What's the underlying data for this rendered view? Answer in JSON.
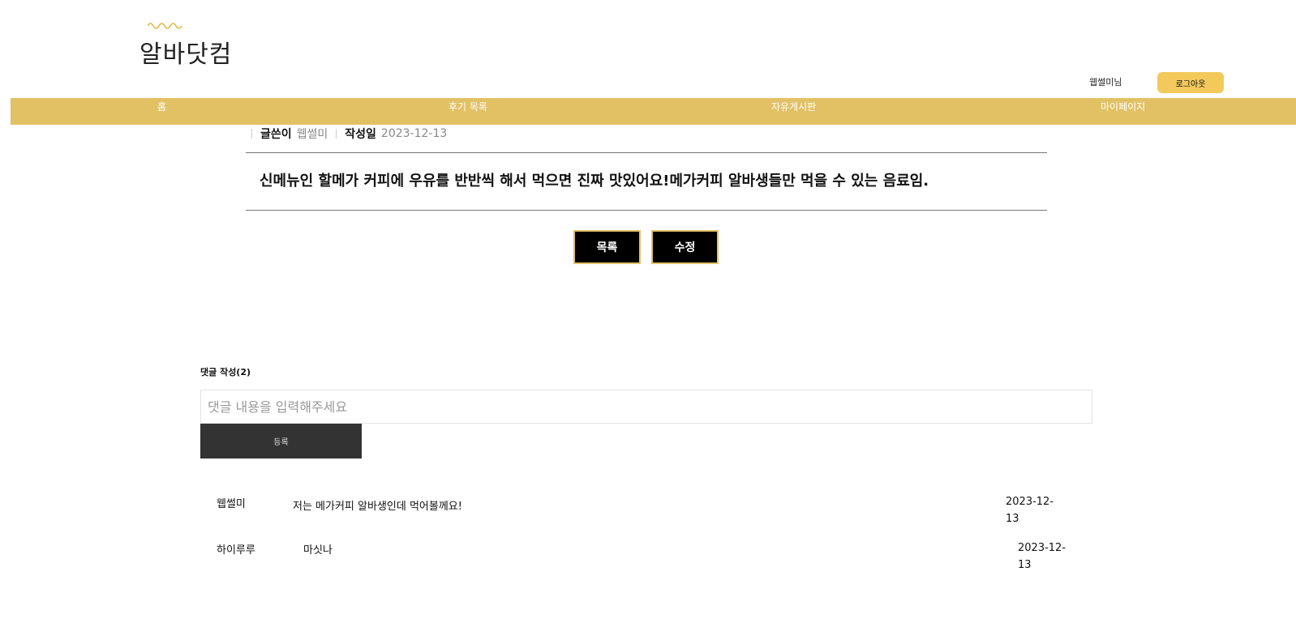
{
  "header": {
    "logo_text": "알바닷컴",
    "user_name": "웹썰미님",
    "logout_label": "로그아웃"
  },
  "nav": {
    "items": [
      {
        "label": "홈"
      },
      {
        "label": "후기 목록"
      },
      {
        "label": "자유게시판"
      },
      {
        "label": "마이페이지"
      }
    ]
  },
  "post": {
    "author_label": "글쓴이",
    "author": "웹썰미",
    "date_label": "작성일",
    "date": "2023-12-13",
    "content": "신메뉴인 할메가 커피에 우유를 반반씩 해서 먹으면 진짜 맛있어요!메가커피 알바생들만 먹을 수 있는 음료임.",
    "list_button": "목록",
    "edit_button": "수정"
  },
  "comments": {
    "heading": "댓글 작성(2)",
    "input_placeholder": "댓글 내용을 입력해주세요",
    "submit_label": "등록",
    "items": [
      {
        "author": "웹썰미",
        "text": "저는 메가커피 알바생인데 먹어볼께요!",
        "date": "2023-12-13"
      },
      {
        "author": "하이루루",
        "text": "마싯나",
        "date": "2023-12-13"
      }
    ]
  },
  "colors": {
    "nav_bar": "#e2c165",
    "logout_button": "#f3c95c",
    "button_dark": "#000000",
    "submit_dark": "#333333"
  }
}
